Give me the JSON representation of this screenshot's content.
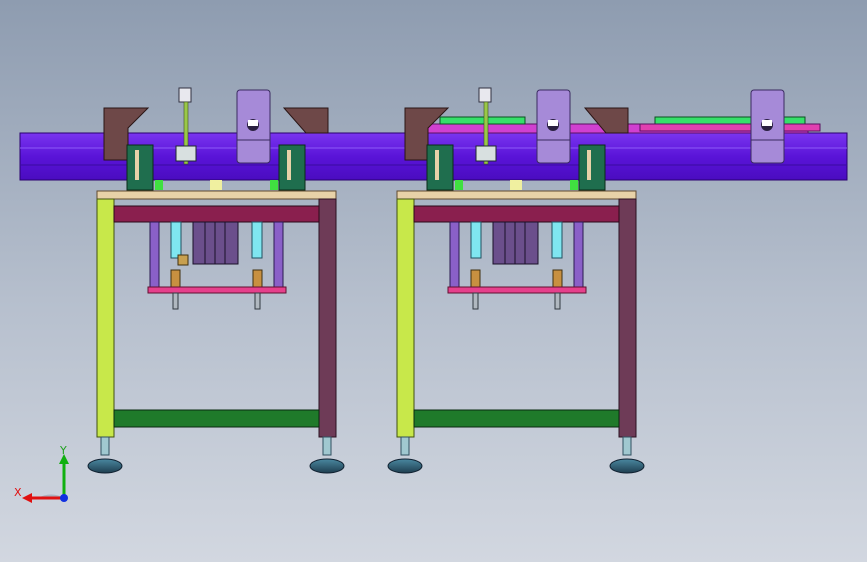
{
  "view": {
    "background_top": "#8e9cb0",
    "background_bottom": "#d2d7e0"
  },
  "triad": {
    "x_label": "X",
    "y_label": "Y",
    "x_color": "#e01010",
    "y_color": "#10b010",
    "z_color": "#1030e0"
  },
  "colors": {
    "conveyor_beam": "#6a1fe6",
    "frame_top_plate": "#e8d2a8",
    "left_leg": "#c8e84a",
    "right_leg": "#6e3b57",
    "crossbar": "#1f7a2a",
    "upper_band": "#8a1f4e",
    "cylinder_rod": "#7fe6f0",
    "cylinder_body": "#6b4f8c",
    "guide_rod": "#8a60c8",
    "pink_plate": "#e6408c",
    "bracket": "#a68ad8",
    "brown_plate": "#6e4848",
    "green_clamp": "#1f6e4e",
    "foot": "#2e5a6e"
  }
}
